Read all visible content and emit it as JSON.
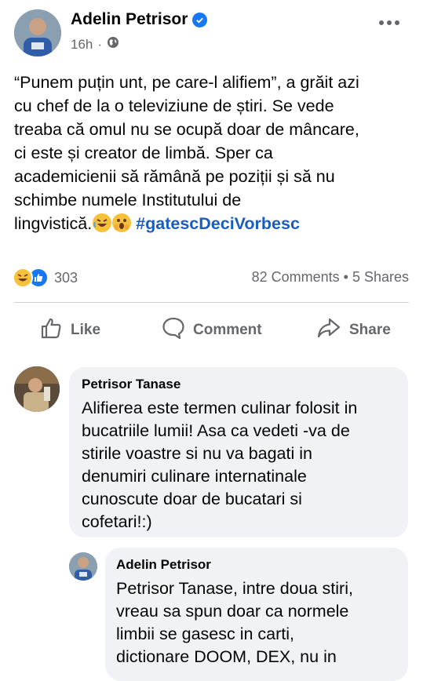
{
  "post": {
    "author": "Adelin Petrisor",
    "time": "16h",
    "lines": [
      "“Punem puțin unt, pe care-l alifiem”, a grăit azi",
      "cu chef de la o televiziune de știri. Se vede",
      "treaba că omul nu se ocupă doar de mâncare,",
      "ci este și creator de limbă. Sper ca",
      "academicienii să rămână pe poziții și să nu",
      "schimbe numele Institutului de"
    ],
    "last_line": "lingvistică.",
    "hashtag": "#gatescDeciVorbesc",
    "reaction_count": "303",
    "counts": "82 Comments • 5 Shares"
  },
  "actions": {
    "like": "Like",
    "comment": "Comment",
    "share": "Share"
  },
  "comments": [
    {
      "author": "Petrisor Tanase",
      "lines": [
        "Alifierea este termen culinar folosit in",
        "bucatriile lumii! Asa ca vedeti -va de",
        "stirile voastre si nu va bagati in",
        "denumiri culinare internatinale",
        "cunoscute doar de bucatari si",
        "cofetari!:)"
      ]
    },
    {
      "author": "Adelin Petrisor",
      "lines": [
        "Petrisor Tanase, intre doua stiri,",
        "vreau sa spun doar ca normele",
        "limbii se gasesc in carti,",
        "dictionare DOOM, DEX, nu in"
      ]
    }
  ],
  "colors": {
    "accent": "#1877f2",
    "hashtag": "#1b5dbf",
    "muted": "#65676b",
    "bubble": "#f0f2f5"
  },
  "icons": {
    "verified": "verified-badge-icon",
    "globe": "globe-icon",
    "more": "more-icon",
    "like": "thumbs-up-icon",
    "comment": "comment-bubble-icon",
    "share": "share-arrow-icon"
  }
}
